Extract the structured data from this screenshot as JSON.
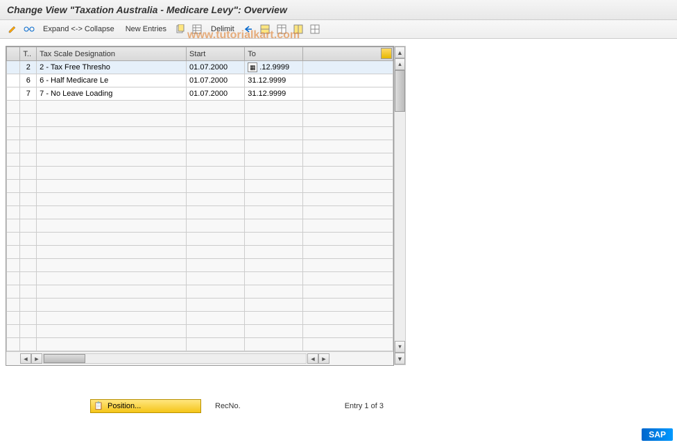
{
  "title": "Change View \"Taxation Australia - Medicare Levy\": Overview",
  "toolbar": {
    "expand_collapse": "Expand <-> Collapse",
    "new_entries": "New Entries",
    "delimit": "Delimit"
  },
  "watermark": "www.tutorialkart.com",
  "table": {
    "headers": {
      "t": "T..",
      "designation": "Tax Scale Designation",
      "start": "Start",
      "to": "To"
    },
    "rows": [
      {
        "t": "2",
        "desig": "2 - Tax Free Thresho",
        "start": "01.07.2000",
        "to": "  .12.9999",
        "selected": true,
        "has_cal": true
      },
      {
        "t": "6",
        "desig": "6 - Half Medicare Le",
        "start": "01.07.2000",
        "to": "31.12.9999",
        "selected": false,
        "has_cal": false
      },
      {
        "t": "7",
        "desig": "7 - No Leave Loading",
        "start": "01.07.2000",
        "to": "31.12.9999",
        "selected": false,
        "has_cal": false
      }
    ]
  },
  "bottom": {
    "position_label": "Position...",
    "recno_label": "RecNo.",
    "recno_value": "",
    "entry_text": "Entry 1 of 3"
  },
  "sap_logo": "SAP"
}
